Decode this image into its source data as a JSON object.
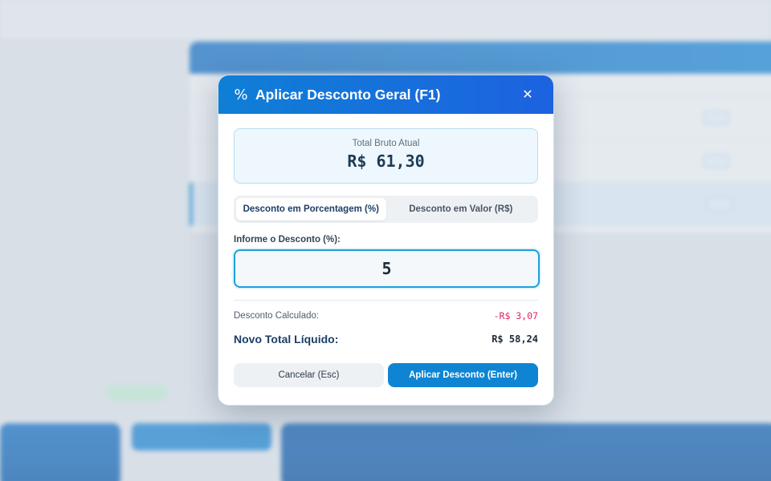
{
  "modal": {
    "icon": "percent-icon",
    "icon_glyph": "%",
    "title": "Aplicar Desconto Geral (F1)",
    "close_glyph": "✕",
    "total_label": "Total Bruto Atual",
    "total_value": "R$ 61,30",
    "tabs": [
      {
        "label": "Desconto em Porcentagem (%)",
        "active": true
      },
      {
        "label": "Desconto em Valor (R$)",
        "active": false
      }
    ],
    "input_label": "Informe o Desconto (%):",
    "input_value": "5",
    "calc_label": "Desconto Calculado:",
    "calc_value": "-R$ 3,07",
    "net_label": "Novo Total Líquido:",
    "net_value": "R$ 58,24",
    "cancel_label": "Cancelar (Esc)",
    "apply_label": "Aplicar Desconto (Enter)"
  },
  "colors": {
    "header_start": "#0f7fd6",
    "header_end": "#1d62e0",
    "accent": "#0f84d3",
    "discount_red": "#e0245e"
  }
}
